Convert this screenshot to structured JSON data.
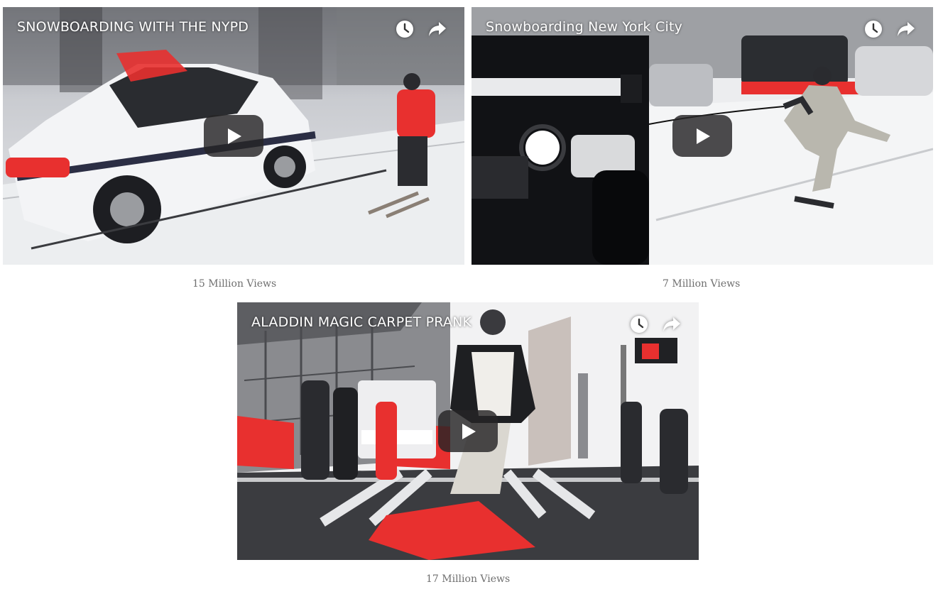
{
  "videos": [
    {
      "title": "SNOWBOARDING WITH THE NYPD",
      "views": "15 Million Views",
      "play_icon": "play-icon",
      "watch_later_icon": "clock-icon",
      "share_icon": "share-arrow-icon"
    },
    {
      "title": "Snowboarding New York City",
      "views": "7 Million Views",
      "play_icon": "play-icon",
      "watch_later_icon": "clock-icon",
      "share_icon": "share-arrow-icon"
    },
    {
      "title": "ALADDIN MAGIC CARPET PRANK",
      "views": "17 Million Views",
      "play_icon": "play-icon",
      "watch_later_icon": "clock-icon",
      "share_icon": "share-arrow-icon"
    }
  ],
  "colors": {
    "views_text": "#6f6f6f",
    "accent_red": "#e8302f",
    "play_button": "#262426"
  }
}
